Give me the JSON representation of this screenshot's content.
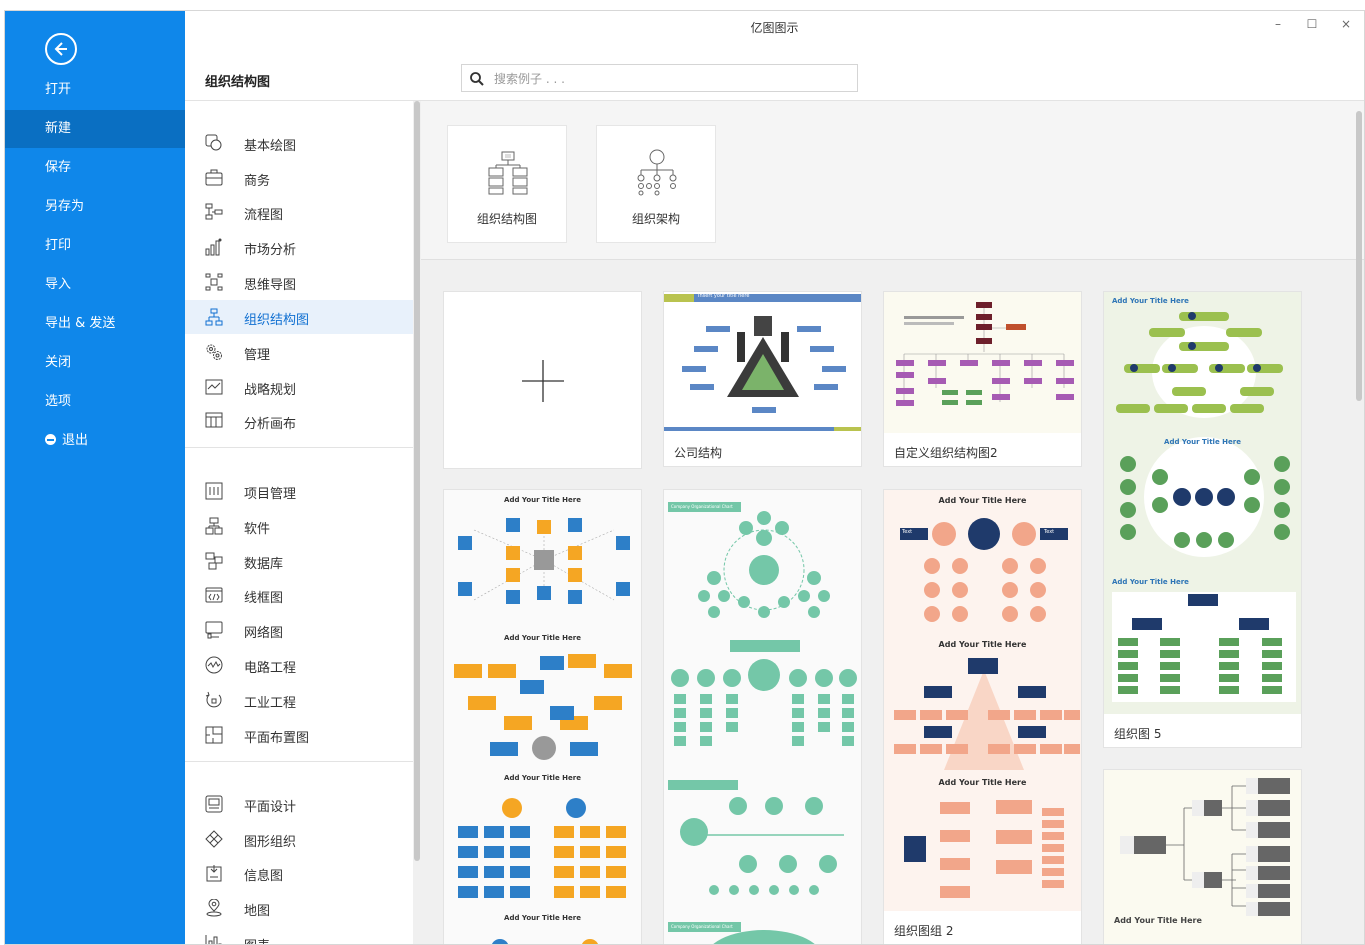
{
  "app": {
    "title": "亿图图示",
    "min": "–",
    "max": "☐",
    "close": "×"
  },
  "leftnav": {
    "items": [
      {
        "label": "打开"
      },
      {
        "label": "新建"
      },
      {
        "label": "保存"
      },
      {
        "label": "另存为"
      },
      {
        "label": "打印"
      },
      {
        "label": "导入"
      },
      {
        "label": "导出 & 发送"
      },
      {
        "label": "关闭"
      },
      {
        "label": "选项"
      },
      {
        "label": "退出"
      }
    ],
    "active_index": 1
  },
  "header": {
    "section_title": "组织结构图",
    "search_placeholder": "搜索例子 . . ."
  },
  "categories": {
    "group1": [
      {
        "label": "基本绘图",
        "icon": "basic-drawing-icon"
      },
      {
        "label": "商务",
        "icon": "briefcase-icon"
      },
      {
        "label": "流程图",
        "icon": "flowchart-icon"
      },
      {
        "label": "市场分析",
        "icon": "bar-chart-icon"
      },
      {
        "label": "思维导图",
        "icon": "mindmap-icon"
      },
      {
        "label": "组织结构图",
        "icon": "org-chart-icon"
      },
      {
        "label": "管理",
        "icon": "gears-icon"
      },
      {
        "label": "战略规划",
        "icon": "strategy-icon"
      },
      {
        "label": "分析画布",
        "icon": "canvas-icon"
      }
    ],
    "group2": [
      {
        "label": "项目管理",
        "icon": "project-icon"
      },
      {
        "label": "软件",
        "icon": "software-icon"
      },
      {
        "label": "数据库",
        "icon": "database-icon"
      },
      {
        "label": "线框图",
        "icon": "wireframe-icon"
      },
      {
        "label": "网络图",
        "icon": "network-icon"
      },
      {
        "label": "电路工程",
        "icon": "circuit-icon"
      },
      {
        "label": "工业工程",
        "icon": "industrial-icon"
      },
      {
        "label": "平面布置图",
        "icon": "floorplan-icon"
      }
    ],
    "group3": [
      {
        "label": "平面设计",
        "icon": "graphic-design-icon"
      },
      {
        "label": "图形组织",
        "icon": "graphic-organizer-icon"
      },
      {
        "label": "信息图",
        "icon": "infographic-icon"
      },
      {
        "label": "地图",
        "icon": "map-pin-icon"
      },
      {
        "label": "图表",
        "icon": "chart-icon"
      }
    ],
    "active_label": "组织结构图"
  },
  "subtypes": [
    {
      "label": "组织结构图"
    },
    {
      "label": "组织架构"
    }
  ],
  "templates": {
    "company": {
      "label": "公司结构",
      "banner": "Insert your title here"
    },
    "custom": {
      "label": "自定义组织结构图2"
    },
    "org5": {
      "label": "组织图 5",
      "title_a": "Add Your Title Here",
      "title_b": "Add Your Title Here",
      "title_c": "Add Your Title Here"
    },
    "col1": {
      "title_a": "Add Your Title Here",
      "title_b": "Add Your Title Here",
      "title_c": "Add Your Title Here",
      "title_d": "Add Your Title Here"
    },
    "col2": {
      "banner_a": "Company Organizational Chart",
      "banner_b": "Company Organizational Chart"
    },
    "group2": {
      "label": "组织图组 2",
      "title_a": "Add Your Title Here",
      "title_b": "Add Your Title Here",
      "title_c": "Add Your Title Here",
      "node_text": "Text"
    },
    "col4b": {
      "title": "Add Your Title Here"
    }
  },
  "colors": {
    "accent": "#0f87ea",
    "nav_active": "#0a6fc2",
    "teal": "#74c7a8",
    "orange": "#f5a623",
    "salmon": "#f2a68a",
    "navy": "#1f3a6b"
  }
}
